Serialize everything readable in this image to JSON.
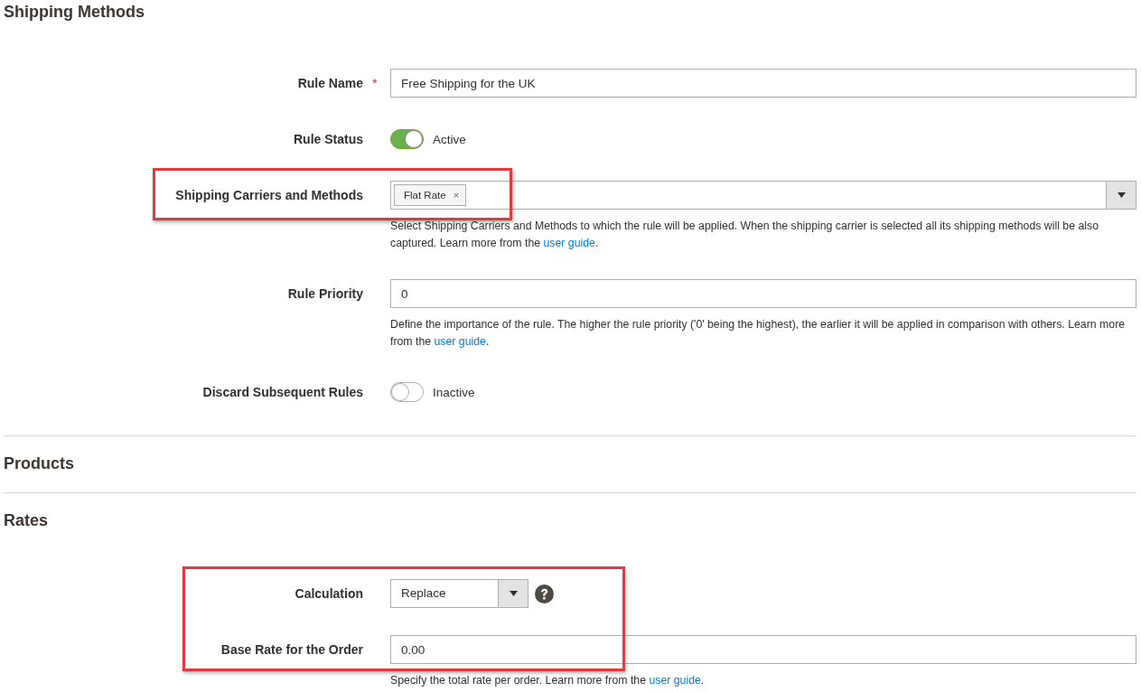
{
  "sections": [
    {
      "title": "Shipping Methods",
      "fields": [
        {
          "kind": "text",
          "label": "Rule Name",
          "required_mark": "*",
          "value": "Free Shipping for the UK"
        },
        {
          "kind": "toggle",
          "label": "Rule Status",
          "on": true,
          "state_text": "Active"
        },
        {
          "kind": "multiselect",
          "label": "Shipping Carriers and Methods",
          "tags": [
            "Flat Rate"
          ],
          "remove_glyph": "×",
          "highlighted": true,
          "note": {
            "text": "Select Shipping Carriers and Methods to which the rule will be applied. When the shipping carrier is selected all its shipping methods will be also captured. Learn more from the ",
            "link": "user guide",
            "after": "."
          }
        },
        {
          "kind": "text",
          "label": "Rule Priority",
          "value": "0",
          "note": {
            "text": "Define the importance of the rule. The higher the rule priority ('0' being the highest), the earlier it will be applied in comparison with others. Learn more from the ",
            "link": "user guide",
            "after": "."
          }
        },
        {
          "kind": "toggle",
          "label": "Discard Subsequent Rules",
          "on": false,
          "state_text": "Inactive"
        }
      ]
    },
    {
      "title": "Products"
    },
    {
      "title": "Rates",
      "fields": [
        {
          "kind": "select",
          "label": "Calculation",
          "value": "Replace",
          "help": true,
          "highlighted": true
        },
        {
          "kind": "text",
          "label": "Base Rate for the Order",
          "value": "0.00",
          "highlighted": true,
          "note": {
            "text": "Specify the total rate per order. Learn more from the ",
            "link": "user guide",
            "after": "."
          }
        }
      ]
    }
  ]
}
